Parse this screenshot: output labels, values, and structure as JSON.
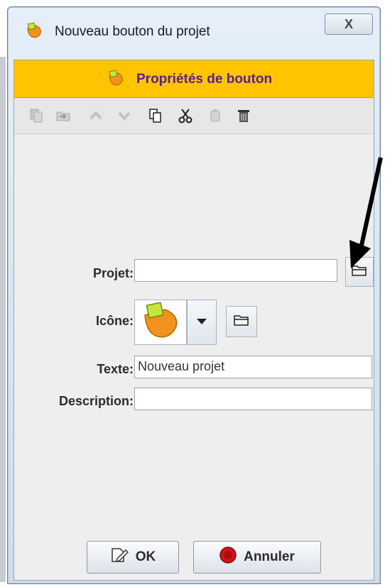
{
  "window": {
    "title": "Nouveau bouton du projet",
    "close_label": "X"
  },
  "panel": {
    "header_title": "Propriétés de bouton"
  },
  "toolbar": {
    "icons": [
      "copy-icon",
      "paste-icon",
      "move-up-icon",
      "move-down-icon",
      "duplicate-icon",
      "cut-icon",
      "delete-icon",
      "trash-icon"
    ]
  },
  "form": {
    "project_label": "Projet:",
    "project_value": "",
    "icon_label": "Icône:",
    "text_label": "Texte:",
    "text_value": "Nouveau projet",
    "description_label": "Description:",
    "description_value": ""
  },
  "buttons": {
    "ok_label": "OK",
    "cancel_label": "Annuler"
  },
  "colors": {
    "header_bg": "#ffc400",
    "header_text": "#5a1f8f",
    "icon_orange": "#f0921c",
    "icon_green": "#c6e63a",
    "cancel_red": "#d3141a"
  }
}
